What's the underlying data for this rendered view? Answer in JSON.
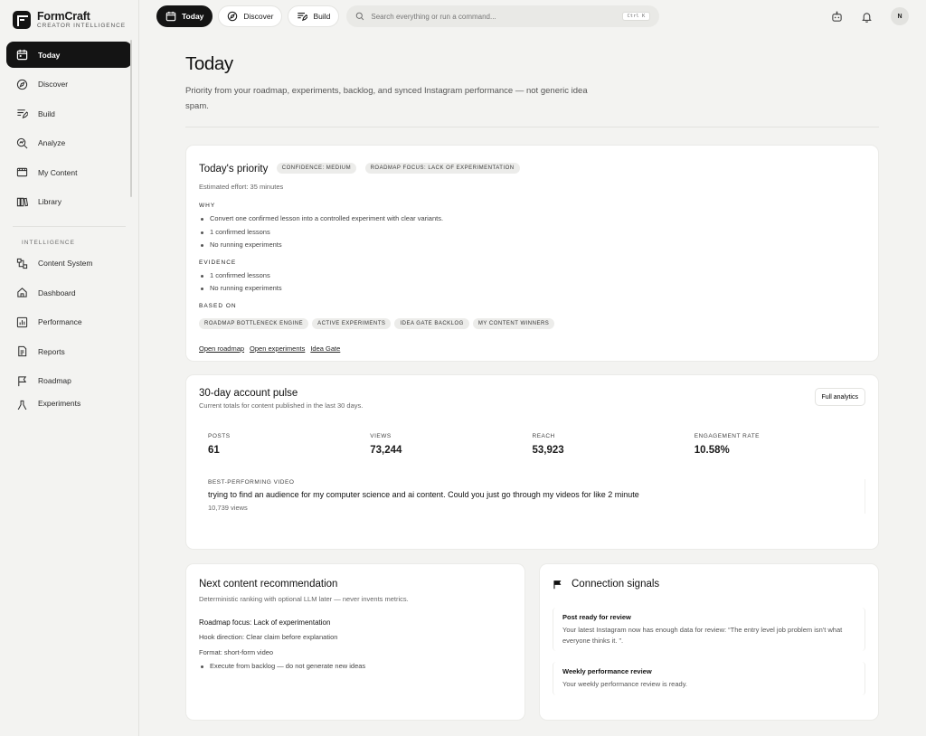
{
  "brand": {
    "name": "FormCraft",
    "sub": "CREATOR INTELLIGENCE"
  },
  "sidebar": {
    "items": [
      {
        "label": "Today",
        "icon": "calendar-icon",
        "active": true
      },
      {
        "label": "Discover",
        "icon": "compass-icon"
      },
      {
        "label": "Build",
        "icon": "build-icon"
      },
      {
        "label": "Analyze",
        "icon": "analyze-icon"
      },
      {
        "label": "My Content",
        "icon": "film-icon"
      },
      {
        "label": "Library",
        "icon": "library-icon"
      }
    ],
    "section_label": "INTELLIGENCE",
    "intel_items": [
      {
        "label": "Content System",
        "icon": "system-icon"
      },
      {
        "label": "Dashboard",
        "icon": "home-icon"
      },
      {
        "label": "Performance",
        "icon": "chart-icon"
      },
      {
        "label": "Reports",
        "icon": "report-icon"
      },
      {
        "label": "Roadmap",
        "icon": "flag-icon"
      },
      {
        "label": "Experiments",
        "icon": "flask-icon"
      }
    ]
  },
  "topbar": {
    "tabs": [
      {
        "label": "Today",
        "active": true
      },
      {
        "label": "Discover"
      },
      {
        "label": "Build"
      }
    ],
    "search_placeholder": "Search everything or run a command...",
    "shortcut": "Ctrl K",
    "avatar": "N"
  },
  "page": {
    "title": "Today",
    "subtitle": "Priority from your roadmap, experiments, backlog, and synced Instagram performance — not generic idea spam."
  },
  "priority": {
    "title": "Today's priority",
    "tags": [
      "CONFIDENCE: MEDIUM",
      "ROADMAP FOCUS: LACK OF EXPERIMENTATION"
    ],
    "effort": "Estimated effort: 35 minutes",
    "why_label": "WHY",
    "why": [
      "Convert one confirmed lesson into a controlled experiment with clear variants.",
      "1 confirmed lessons",
      "No running experiments"
    ],
    "evidence_label": "EVIDENCE",
    "evidence": [
      "1 confirmed lessons",
      "No running experiments"
    ],
    "based_label": "BASED ON",
    "based_on": [
      "ROADMAP BOTTLENECK ENGINE",
      "ACTIVE EXPERIMENTS",
      "IDEA GATE BACKLOG",
      "MY CONTENT WINNERS"
    ],
    "links": [
      "Open roadmap",
      "Open experiments",
      "Idea Gate"
    ]
  },
  "pulse": {
    "title": "30-day account pulse",
    "sub": "Current totals for content published in the last 30 days.",
    "button": "Full analytics",
    "stats": [
      {
        "label": "POSTS",
        "value": "61"
      },
      {
        "label": "VIEWS",
        "value": "73,244"
      },
      {
        "label": "REACH",
        "value": "53,923"
      },
      {
        "label": "ENGAGEMENT RATE",
        "value": "10.58%"
      }
    ],
    "best_label": "BEST-PERFORMING VIDEO",
    "best_title": "trying to find an audience for my computer science and ai content. Could you just go through my videos for like 2 minute",
    "best_views": "10,739 views"
  },
  "recommendation": {
    "title": "Next content recommendation",
    "sub": "Deterministic ranking with optional LLM later — never invents metrics.",
    "focus": "Roadmap focus: Lack of experimentation",
    "hook": "Hook direction: Clear claim before explanation",
    "format": "Format: short-form video",
    "bullets": [
      "Execute from backlog — do not generate new ideas"
    ]
  },
  "signals": {
    "title": "Connection signals",
    "items": [
      {
        "title": "Post ready for review",
        "body": "Your latest Instagram now has enough data for review: “The entry level job problem isn't what everyone thinks it. ”."
      },
      {
        "title": "Weekly performance review",
        "body": "Your weekly performance review is ready."
      }
    ]
  }
}
